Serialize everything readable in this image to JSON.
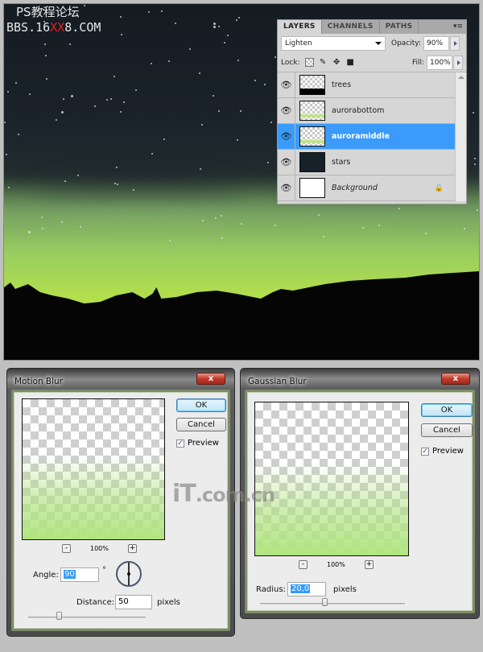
{
  "watermark_top": {
    "line1": "PS教程论坛",
    "line2_pre": "BBS.16",
    "line2_red": "XX",
    "line2_post": "8.COM"
  },
  "watermark_center": {
    "text_big": "iT",
    "text_small": ".com.cn"
  },
  "layers_panel": {
    "tabs": [
      {
        "label": "LAYERS",
        "active": true
      },
      {
        "label": "CHANNELS",
        "active": false
      },
      {
        "label": "PATHS",
        "active": false
      }
    ],
    "menu_icon": "panel-menu-icon",
    "blend_mode": "Lighten",
    "opacity_label": "Opacity:",
    "opacity_value": "90%",
    "lock_label": "Lock:",
    "lock_icons": [
      "lock-transparent-icon",
      "lock-brush-icon",
      "lock-move-icon",
      "lock-all-icon"
    ],
    "fill_label": "Fill:",
    "fill_value": "100%",
    "layers": [
      {
        "name": "trees",
        "visible": true,
        "selected": false,
        "thumbnail": "trees"
      },
      {
        "name": "aurorabottom",
        "visible": true,
        "selected": false,
        "thumbnail": "aurora"
      },
      {
        "name": "auroramiddle",
        "visible": true,
        "selected": true,
        "thumbnail": "aurora"
      },
      {
        "name": "stars",
        "visible": true,
        "selected": false,
        "thumbnail": "stars"
      },
      {
        "name": "Background",
        "visible": true,
        "selected": false,
        "thumbnail": "white",
        "locked": true
      }
    ]
  },
  "motion_blur": {
    "title": "Motion Blur",
    "close_label": "x",
    "ok_label": "OK",
    "cancel_label": "Cancel",
    "preview_label": "Preview",
    "preview_checked": true,
    "zoom_minus": "-",
    "zoom_value": "100%",
    "zoom_plus": "+",
    "angle_label": "Angle:",
    "angle_value": "90",
    "angle_unit": "°",
    "distance_label": "Distance:",
    "distance_value": "50",
    "distance_unit": "pixels",
    "slider_fraction": 0.27
  },
  "gaussian_blur": {
    "title": "Gaussian Blur",
    "close_label": "x",
    "ok_label": "OK",
    "cancel_label": "Cancel",
    "preview_label": "Preview",
    "preview_checked": true,
    "zoom_minus": "-",
    "zoom_value": "100%",
    "zoom_plus": "+",
    "radius_label": "Radius:",
    "radius_value": "20,0",
    "radius_unit": "pixels",
    "slider_fraction": 0.45
  }
}
